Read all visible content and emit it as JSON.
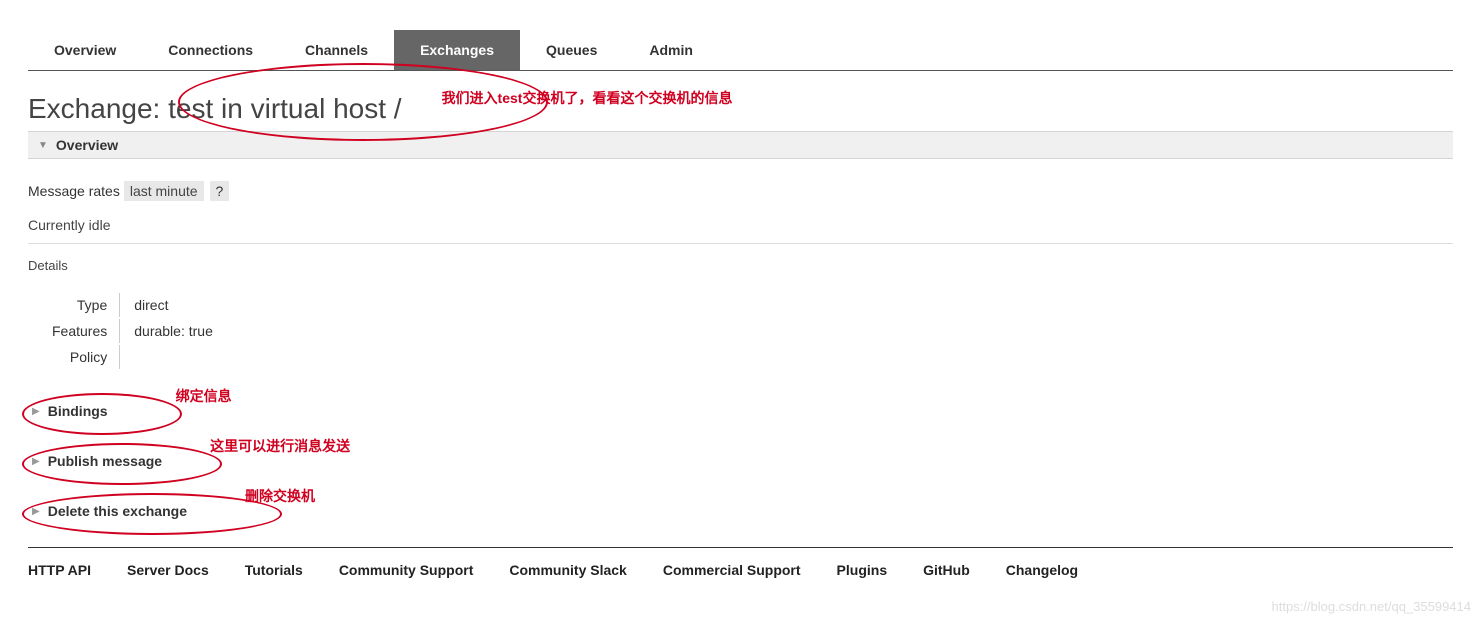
{
  "tabs": {
    "overview": "Overview",
    "connections": "Connections",
    "channels": "Channels",
    "exchanges": "Exchanges",
    "queues": "Queues",
    "admin": "Admin"
  },
  "title": {
    "prefix": "Exchange: ",
    "name": "test",
    "vhost_prefix": " in virtual host ",
    "vhost": "/"
  },
  "annotations": {
    "title": "我们进入test交换机了，看看这个交换机的信息",
    "bindings": "绑定信息",
    "publish": "这里可以进行消息发送",
    "delete": "删除交换机"
  },
  "sections": {
    "overview": "Overview",
    "bindings": "Bindings",
    "publish": "Publish message",
    "delete": "Delete this exchange"
  },
  "message_rates": {
    "label": "Message rates",
    "period": "last minute",
    "help": "?"
  },
  "idle_text": "Currently idle",
  "details_label": "Details",
  "details": {
    "type_label": "Type",
    "type_value": "direct",
    "features_label": "Features",
    "features_value": "durable: true",
    "policy_label": "Policy",
    "policy_value": ""
  },
  "footer": {
    "http_api": "HTTP API",
    "server_docs": "Server Docs",
    "tutorials": "Tutorials",
    "community_support": "Community Support",
    "community_slack": "Community Slack",
    "commercial_support": "Commercial Support",
    "plugins": "Plugins",
    "github": "GitHub",
    "changelog": "Changelog"
  },
  "watermark": "https://blog.csdn.net/qq_35599414"
}
